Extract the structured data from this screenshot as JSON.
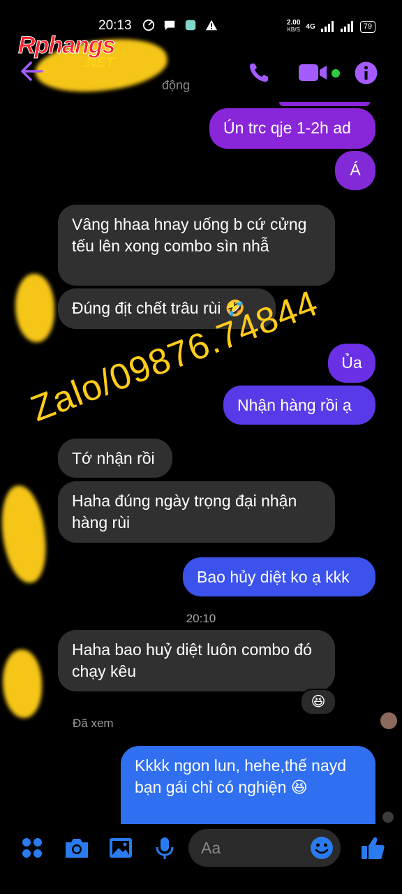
{
  "status_bar": {
    "time": "20:13",
    "net_speed": "2.00",
    "net_unit": "KB/S",
    "network": "4G",
    "battery": "79"
  },
  "watermark": {
    "logo_main": "Rphangs",
    "logo_sub": ".NET",
    "phone_overlay": "Zalo/09876.74844"
  },
  "header": {
    "active_status": "động"
  },
  "messages": [
    {
      "side": "out",
      "text": "Ún trc qje 1-2h ad"
    },
    {
      "side": "out",
      "text": "Á"
    },
    {
      "side": "in",
      "text": "Vâng hhaa hnay uống b cứ cửng tếu lên xong combo sìn nhẫ"
    },
    {
      "side": "in",
      "text": "Đúng địt chết trâu rùi 🤣"
    },
    {
      "side": "out",
      "text": "Ủa"
    },
    {
      "side": "out",
      "text": "Nhận hàng rồi ạ"
    },
    {
      "side": "in",
      "text": "Tớ nhận rồi"
    },
    {
      "side": "in",
      "text": "Haha đúng ngày trọng đại nhận hàng rùi"
    },
    {
      "side": "out",
      "text": "Bao hủy diệt ko ạ kkk"
    },
    {
      "side": "in",
      "text": "Haha bao huỷ diệt luôn combo đó chạy kêu"
    },
    {
      "side": "out",
      "text": "Kkkk ngon lun, hehe,thế nayd bạn gái chỉ có nghiện 😆"
    }
  ],
  "timestamp": "20:10",
  "reaction": "😆",
  "seen_label": "Đã xem",
  "composer": {
    "placeholder": "Aa"
  },
  "colors": {
    "accent": "#a45cff",
    "bubble_in": "#303030",
    "bubble_out_purple": "#8a26d9",
    "bubble_out_indigo": "#5a3ae8",
    "bubble_out_blue": "#2f6ff0",
    "bubble_out_blue2": "#2a7bf0"
  },
  "icons": [
    "back-arrow-icon",
    "phone-icon",
    "video-icon",
    "info-icon",
    "menu-dots-icon",
    "camera-icon",
    "gallery-icon",
    "microphone-icon",
    "emoji-icon",
    "thumbs-up-icon"
  ]
}
